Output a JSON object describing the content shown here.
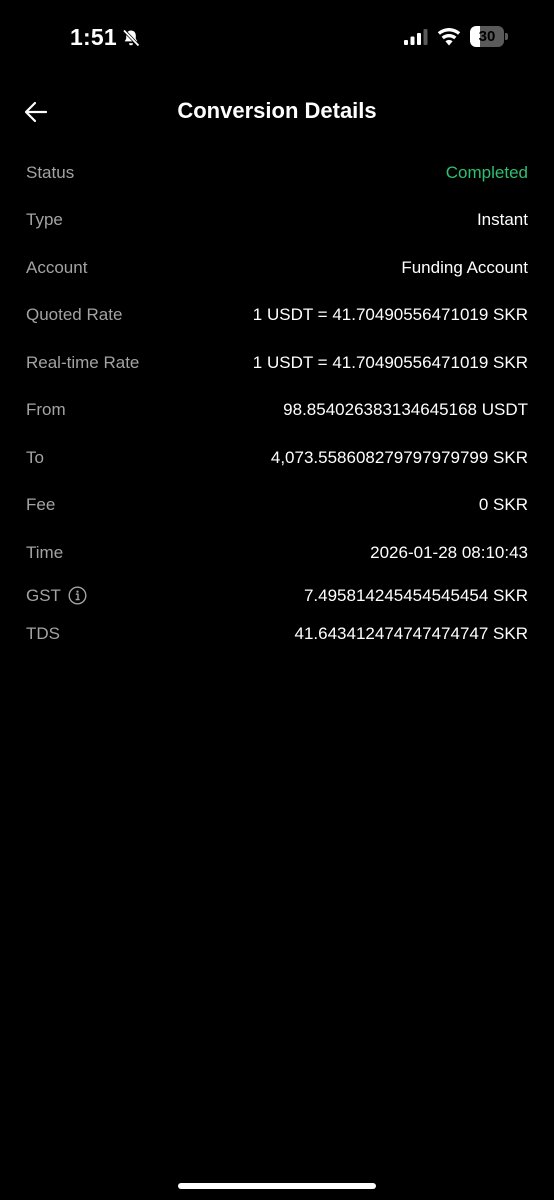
{
  "status_bar": {
    "time": "1:51",
    "battery_level": "30",
    "battery_percent": 30
  },
  "header": {
    "title": "Conversion Details"
  },
  "details": [
    {
      "label": "Status",
      "value": "Completed"
    },
    {
      "label": "Type",
      "value": "Instant"
    },
    {
      "label": "Account",
      "value": "Funding Account"
    },
    {
      "label": "Quoted Rate",
      "value": "1 USDT = 41.70490556471019 SKR"
    },
    {
      "label": "Real-time Rate",
      "value": "1 USDT = 41.70490556471019 SKR"
    },
    {
      "label": "From",
      "value": "98.854026383134645168 USDT"
    },
    {
      "label": "To",
      "value": "4,073.558608279797979799 SKR"
    },
    {
      "label": "Fee",
      "value": "0 SKR"
    },
    {
      "label": "Time",
      "value": "2026-01-28 08:10:43"
    },
    {
      "label": "GST",
      "value": "7.495814245454545454 SKR"
    },
    {
      "label": "TDS",
      "value": "41.643412474747474747 SKR"
    }
  ],
  "colors": {
    "background": "#000000",
    "label": "#a3a3a3",
    "value": "#ffffff",
    "status_completed": "#2fbf71"
  },
  "icons": {
    "back": "arrow-left-icon",
    "info": "info-icon",
    "silent": "bell-slash-icon",
    "signal": "cellular-signal-icon",
    "wifi": "wifi-icon",
    "battery": "battery-icon"
  }
}
